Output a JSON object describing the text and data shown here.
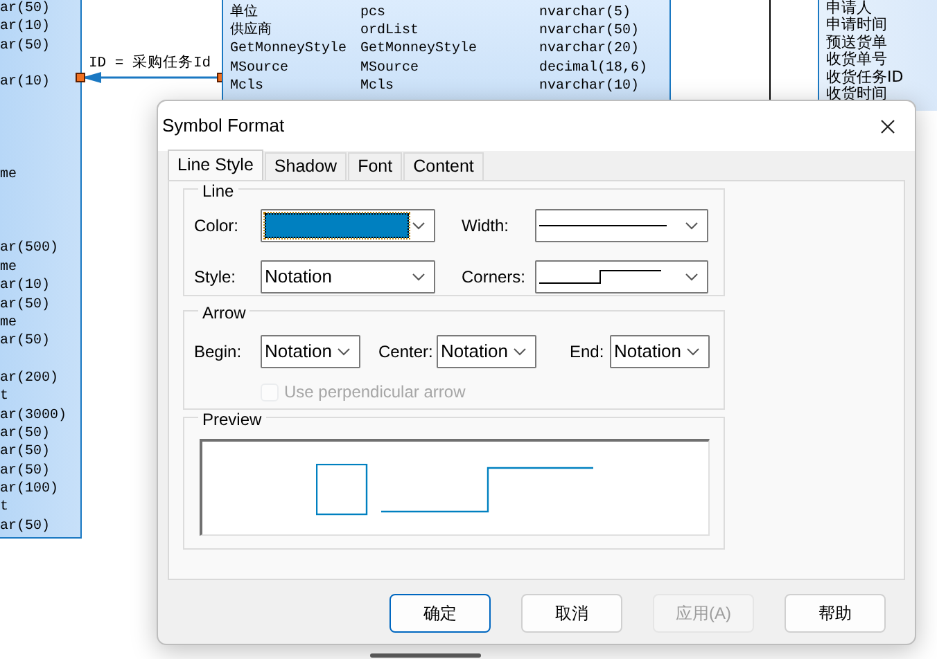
{
  "diagram": {
    "left_table": {
      "rows": [
        {
          "kind": "text",
          "text": "ar(50)"
        },
        {
          "kind": "text",
          "text": "ar(10)"
        },
        {
          "kind": "text",
          "text": "ar(50)"
        },
        {
          "kind": "blank"
        },
        {
          "kind": "text",
          "text": "ar(10)"
        },
        {
          "kind": "blank"
        },
        {
          "kind": "blank"
        },
        {
          "kind": "blank"
        },
        {
          "kind": "blank"
        },
        {
          "kind": "text",
          "text": "me"
        },
        {
          "kind": "blank"
        },
        {
          "kind": "blank"
        },
        {
          "kind": "blank"
        },
        {
          "kind": "text",
          "text": "ar(500)"
        },
        {
          "kind": "text",
          "text": "me"
        },
        {
          "kind": "text",
          "text": "ar(10)"
        },
        {
          "kind": "text",
          "text": "ar(50)"
        },
        {
          "kind": "text",
          "text": "me"
        },
        {
          "kind": "text",
          "text": "ar(50)"
        },
        {
          "kind": "blank"
        },
        {
          "kind": "text",
          "text": "ar(200)"
        },
        {
          "kind": "text",
          "text": "t"
        },
        {
          "kind": "text",
          "text": "ar(3000)"
        },
        {
          "kind": "text",
          "text": "ar(50)"
        },
        {
          "kind": "text",
          "text": "ar(50)"
        },
        {
          "kind": "text",
          "text": "ar(50)"
        },
        {
          "kind": "text",
          "text": "ar(100)"
        },
        {
          "kind": "text",
          "text": "t"
        },
        {
          "kind": "text",
          "text": "ar(50)"
        }
      ]
    },
    "relation": {
      "label": "ID = 采购任务Id",
      "selected": true
    },
    "middle_table": {
      "rows": [
        {
          "cells": [
            "单位",
            "pcs",
            "nvarchar(5)"
          ]
        },
        {
          "cells": [
            "供应商",
            "ordList",
            "nvarchar(50)"
          ]
        },
        {
          "cells": [
            "GetMonneyStyle",
            "GetMonneyStyle",
            "nvarchar(20)"
          ]
        },
        {
          "cells": [
            "MSource",
            "MSource",
            "decimal(18,6)"
          ]
        },
        {
          "cells": [
            "Mcls",
            "Mcls",
            "nvarchar(10)"
          ]
        }
      ]
    },
    "right_table": {
      "rows": [
        "申请人",
        "申请时间",
        "预送货单",
        "收货单号",
        "收货任务ID",
        "收货时间"
      ]
    }
  },
  "dialog": {
    "title": "Symbol Format",
    "tabs": [
      {
        "label": "Line Style",
        "selected": true
      },
      {
        "label": "Shadow",
        "selected": false
      },
      {
        "label": "Font",
        "selected": false
      },
      {
        "label": "Content",
        "selected": false
      }
    ],
    "line_group": {
      "title": "Line",
      "color_label": "Color:",
      "color": "#0080c0",
      "width_label": "Width:",
      "style_label": "Style:",
      "style_value": "Notation",
      "corners_label": "Corners:"
    },
    "arrow_group": {
      "title": "Arrow",
      "begin_label": "Begin:",
      "begin_value": "Notation",
      "center_label": "Center:",
      "center_value": "Notation",
      "end_label": "End:",
      "end_value": "Notation",
      "perpendicular": {
        "label": "Use perpendicular arrow",
        "checked": false,
        "disabled": true
      }
    },
    "preview": {
      "title": "Preview"
    },
    "buttons": [
      {
        "label": "确定",
        "default": true,
        "disabled": false
      },
      {
        "label": "取消",
        "default": false,
        "disabled": false
      },
      {
        "label": "应用(A)",
        "default": false,
        "disabled": true
      },
      {
        "label": "帮助",
        "default": false,
        "disabled": false
      }
    ]
  }
}
